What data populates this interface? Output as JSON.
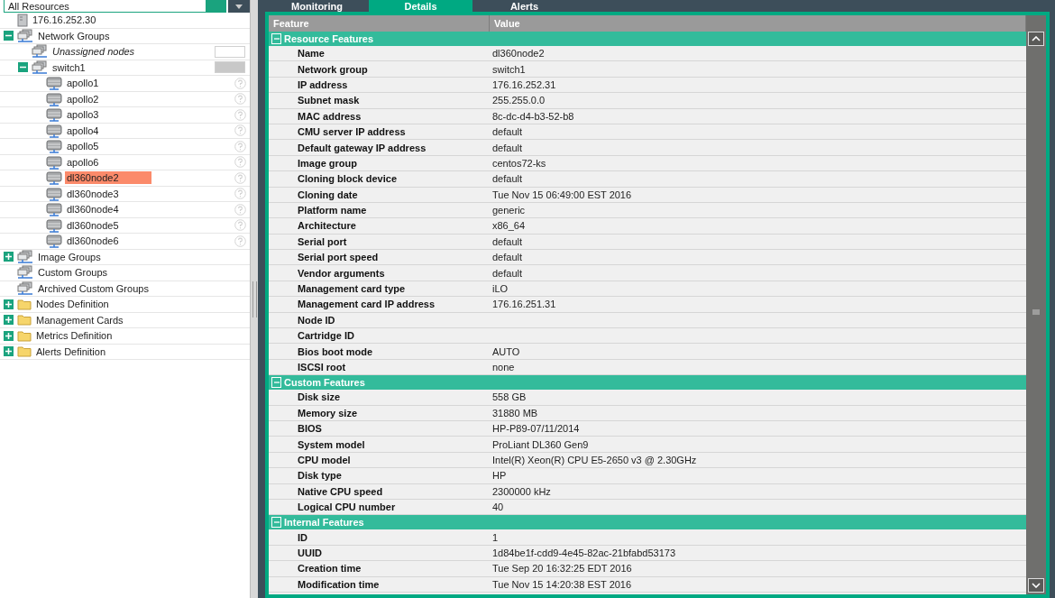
{
  "resource_select": {
    "value": "All Resources"
  },
  "tree": [
    {
      "label": "176.16.252.30",
      "kind": "host"
    },
    {
      "label": "Network Groups",
      "kind": "group",
      "expanded": true,
      "children": [
        {
          "label": "Unassigned nodes",
          "kind": "unassigned",
          "color": "#ffffff"
        },
        {
          "label": "switch1",
          "kind": "group",
          "expanded": true,
          "color": "#c8c8c8",
          "children": [
            {
              "label": "apollo1",
              "kind": "node",
              "selected": false
            },
            {
              "label": "apollo2",
              "kind": "node",
              "selected": false
            },
            {
              "label": "apollo3",
              "kind": "node",
              "selected": false
            },
            {
              "label": "apollo4",
              "kind": "node",
              "selected": false
            },
            {
              "label": "apollo5",
              "kind": "node",
              "selected": false
            },
            {
              "label": "apollo6",
              "kind": "node",
              "selected": false
            },
            {
              "label": "dl360node2",
              "kind": "node",
              "selected": true
            },
            {
              "label": "dl360node3",
              "kind": "node",
              "selected": false
            },
            {
              "label": "dl360node4",
              "kind": "node",
              "selected": false
            },
            {
              "label": "dl360node5",
              "kind": "node",
              "selected": false
            },
            {
              "label": "dl360node6",
              "kind": "node",
              "selected": false
            }
          ]
        }
      ]
    },
    {
      "label": "Image Groups",
      "kind": "group",
      "expanded": false
    },
    {
      "label": "Custom Groups",
      "kind": "group"
    },
    {
      "label": "Archived Custom Groups",
      "kind": "group"
    },
    {
      "label": "Nodes Definition",
      "kind": "folder",
      "expanded": false
    },
    {
      "label": "Management Cards",
      "kind": "folder",
      "expanded": false
    },
    {
      "label": "Metrics Definition",
      "kind": "folder",
      "expanded": false
    },
    {
      "label": "Alerts Definition",
      "kind": "folder",
      "expanded": false
    }
  ],
  "tabs": [
    {
      "label": "Monitoring",
      "selected": false
    },
    {
      "label": "Details",
      "selected": true
    },
    {
      "label": "Alerts",
      "selected": false
    }
  ],
  "table": {
    "columns": [
      "Feature",
      "Value"
    ],
    "sections": [
      {
        "title": "Resource Features",
        "expanded": true,
        "rows": [
          {
            "feature": "Name",
            "value": "dl360node2"
          },
          {
            "feature": "Network group",
            "value": "switch1"
          },
          {
            "feature": "IP address",
            "value": "176.16.252.31"
          },
          {
            "feature": "Subnet mask",
            "value": "255.255.0.0"
          },
          {
            "feature": "MAC address",
            "value": "8c-dc-d4-b3-52-b8"
          },
          {
            "feature": "CMU server IP address",
            "value": "default"
          },
          {
            "feature": "Default gateway IP address",
            "value": "default"
          },
          {
            "feature": "Image group",
            "value": "centos72-ks"
          },
          {
            "feature": "Cloning block device",
            "value": "default"
          },
          {
            "feature": "Cloning date",
            "value": "Tue Nov 15 06:49:00 EST 2016"
          },
          {
            "feature": "Platform name",
            "value": "generic"
          },
          {
            "feature": "Architecture",
            "value": "x86_64"
          },
          {
            "feature": "Serial port",
            "value": "default"
          },
          {
            "feature": "Serial port speed",
            "value": "default"
          },
          {
            "feature": "Vendor arguments",
            "value": "default"
          },
          {
            "feature": "Management card type",
            "value": "iLO"
          },
          {
            "feature": "Management card IP address",
            "value": "176.16.251.31"
          },
          {
            "feature": "Node ID"
          },
          {
            "feature": "Cartridge ID"
          },
          {
            "feature": "Bios boot mode",
            "value": "AUTO"
          },
          {
            "feature": "ISCSI root",
            "value": "none"
          }
        ]
      },
      {
        "title": "Custom Features",
        "expanded": true,
        "rows": [
          {
            "feature": "Disk size",
            "value": "558 GB"
          },
          {
            "feature": "Memory size",
            "value": "31880 MB"
          },
          {
            "feature": "BIOS",
            "value": "HP-P89-07/11/2014"
          },
          {
            "feature": "System model",
            "value": "ProLiant DL360 Gen9"
          },
          {
            "feature": "CPU model",
            "value": "Intel(R) Xeon(R) CPU E5-2650 v3 @ 2.30GHz"
          },
          {
            "feature": "Disk type",
            "value": "HP"
          },
          {
            "feature": "Native CPU speed",
            "value": "2300000 kHz"
          },
          {
            "feature": "Logical CPU number",
            "value": "40"
          }
        ]
      },
      {
        "title": "Internal Features",
        "expanded": true,
        "rows": [
          {
            "feature": "ID",
            "value": "1"
          },
          {
            "feature": "UUID",
            "value": "1d84be1f-cdd9-4e45-82ac-21bfabd53173"
          },
          {
            "feature": "Creation time",
            "value": "Tue Sep 20 16:32:25 EDT 2016"
          },
          {
            "feature": "Modification time",
            "value": "Tue Nov 15 14:20:38 EST 2016"
          }
        ]
      }
    ]
  }
}
